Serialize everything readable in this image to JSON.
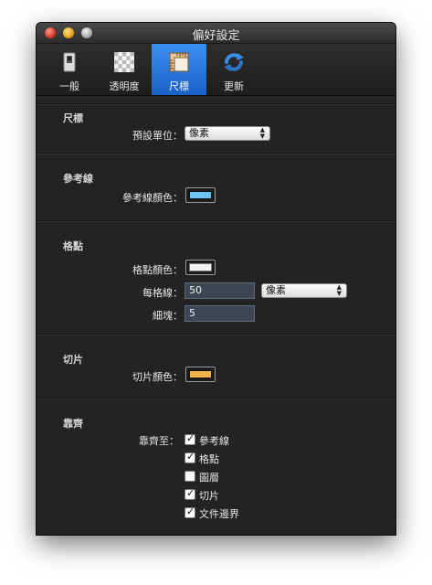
{
  "window": {
    "title": "偏好設定"
  },
  "toolbar": {
    "tabs": [
      {
        "label": "一般",
        "icon": "switch-icon"
      },
      {
        "label": "透明度",
        "icon": "checkerboard-icon"
      },
      {
        "label": "尺標",
        "icon": "ruler-icon",
        "active": true
      },
      {
        "label": "更新",
        "icon": "refresh-icon"
      }
    ]
  },
  "rulers": {
    "title": "尺標",
    "default_unit_label": "預設單位：",
    "default_unit_value": "像素"
  },
  "guides": {
    "title": "參考線",
    "color_label": "參考線顏色：",
    "color": "#6fc3f0"
  },
  "grid": {
    "title": "格點",
    "color_label": "格點顏色：",
    "color": "#f2f2f2",
    "gridline_label": "每格線：",
    "gridline_value": "50",
    "gridline_unit": "像素",
    "subdivision_label": "細塊：",
    "subdivision_value": "5"
  },
  "slices": {
    "title": "切片",
    "color_label": "切片顏色：",
    "color": "#f0b24a"
  },
  "snap": {
    "title": "靠齊",
    "label": "靠齊至：",
    "options": [
      {
        "label": "參考線",
        "checked": true
      },
      {
        "label": "格點",
        "checked": true
      },
      {
        "label": "圖層",
        "checked": false
      },
      {
        "label": "切片",
        "checked": true
      },
      {
        "label": "文件邊界",
        "checked": true
      }
    ]
  }
}
